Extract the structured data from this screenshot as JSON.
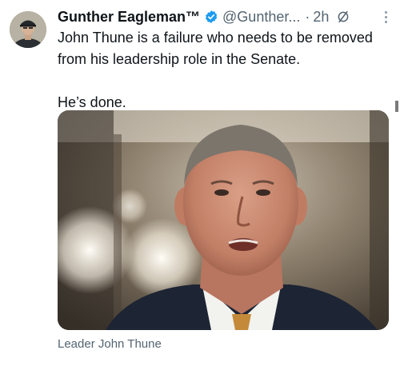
{
  "tweet": {
    "author": {
      "display_name": "Gunther Eagleman™",
      "handle": "@Gunther...",
      "verified": true,
      "avatar_icon": "avatar-photo"
    },
    "separator": "·",
    "timestamp": "2h",
    "icons": {
      "verified": "verified-badge-icon",
      "engagement": "no-symbol-icon",
      "more": "more-options-icon"
    },
    "body": {
      "line1": "John Thune is a failure who needs to be removed from his leadership role in the Senate.",
      "line2": "He’s done."
    },
    "media": {
      "type": "photo",
      "caption": "Leader John Thune"
    },
    "colors": {
      "text": "#0f1419",
      "secondary": "#536471",
      "verified": "#1d9bf0"
    }
  }
}
